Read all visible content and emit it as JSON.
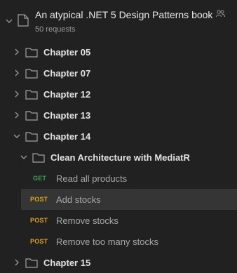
{
  "collection": {
    "title": "An atypical .NET 5 Design Patterns book",
    "subtitle": "50 requests",
    "shared_icon": "people-icon"
  },
  "folders_top": [
    {
      "label": "Chapter 05"
    },
    {
      "label": "Chapter 07"
    },
    {
      "label": "Chapter 12"
    },
    {
      "label": "Chapter 13"
    },
    {
      "label": "Chapter 14"
    }
  ],
  "subfolder": {
    "label": "Clean Architecture with MediatR"
  },
  "requests": [
    {
      "method": "GET",
      "label": "Read all products"
    },
    {
      "method": "POST",
      "label": "Add stocks"
    },
    {
      "method": "POST",
      "label": "Remove stocks"
    },
    {
      "method": "POST",
      "label": "Remove too many stocks"
    }
  ],
  "folder_bottom": {
    "label": "Chapter 15"
  },
  "colors": {
    "background": "#212121",
    "selected_row": "#353535",
    "get": "#3aa058",
    "post": "#e0a31f"
  }
}
